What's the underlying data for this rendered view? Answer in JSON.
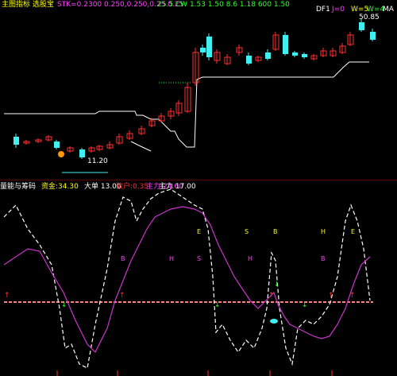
{
  "top_panel": {
    "header_title": "主图指标 选股宝",
    "header_params": "STK=0.2300 0.250,0.250,0.25 0.25",
    "header_extra": "25.5  CW  1.53  1.50  8.6  1.18  600  1.50",
    "right_labels": [
      "DF1",
      "J=0",
      "W=5",
      "W=4",
      "MA"
    ],
    "high_label": "50.85",
    "low_label": "11.20"
  },
  "bottom_panel": {
    "title": "量能与筹码",
    "field1": "资金:34.30",
    "field2": "大单 13.00",
    "field3": "散户:0.35",
    "field4": "主力:24.60",
    "field5": "主力 17.00"
  },
  "markers": {
    "buy_label": "B",
    "sell_label": "S",
    "exit_label": "E",
    "hold_label": "H"
  },
  "colors": {
    "background": "#000000",
    "up_candle": "#ff3030",
    "down_candle": "#40f0f0",
    "stop_line": "#ffffff",
    "kdj_line": "#ffffff",
    "magenta_line": "#cc33cc",
    "base_line": "#ff8080",
    "text_yellow": "#ffff00",
    "text_red": "#ff3030",
    "text_green": "#30ff30",
    "text_magenta": "#ff40ff",
    "text_white": "#ffffff",
    "text_cyan": "#40f0f0"
  }
}
